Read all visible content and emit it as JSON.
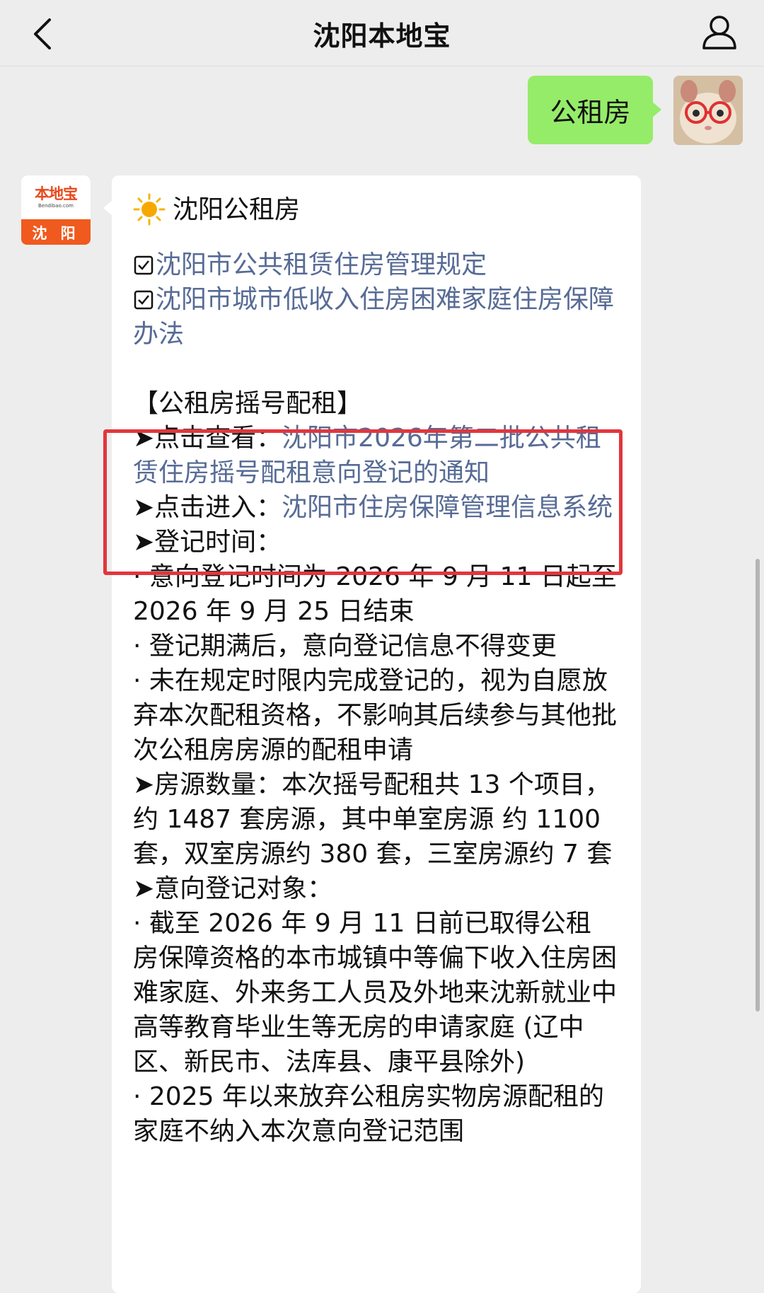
{
  "nav": {
    "title": "沈阳本地宝"
  },
  "user_message": {
    "text": "公租房"
  },
  "bot_avatar": {
    "brand": "本地宝",
    "url": "Bendibao.com",
    "city": "沈 阳"
  },
  "bot_message": {
    "heading": "沈阳公租房",
    "links": [
      "沈阳市公共租赁住房管理规定",
      "沈阳市城市低收入住房困难家庭住房保障办法"
    ],
    "section_title": "【公租房摇号配租】",
    "highlight_items": [
      {
        "prefix": "➤点击查看：",
        "link": "沈阳市2026年第二批公共租赁住房摇号配租意向登记的通知"
      },
      {
        "prefix": "➤点击进入：",
        "link": "沈阳市住房保障管理信息系统"
      }
    ],
    "body_lines": [
      "➤登记时间：",
      "· 意向登记时间为 2026 年 9 月 11 日起至 2026 年 9 月 25 日结束",
      "· 登记期满后，意向登记信息不得变更",
      "· 未在规定时限内完成登记的，视为自愿放弃本次配租资格，不影响其后续参与其他批次公租房房源的配租申请",
      "➤房源数量：本次摇号配租共 13 个项目，约 1487 套房源，其中单室房源 约 1100 套，双室房源约 380 套，三室房源约 7 套",
      "➤意向登记对象：",
      "· 截至 2026 年 9 月 11 日前已取得公租 房保障资格的本市城镇中等偏下收入住房困难家庭、外来务工人员及外地来沈新就业中高等教育毕业生等无房的申请家庭 (辽中区、新民市、法库县、康平县除外)",
      "· 2025 年以来放弃公租房实物房源配租的家庭不纳入本次意向登记范围"
    ]
  },
  "colors": {
    "background": "#ededed",
    "user_bubble": "#95ec69",
    "link": "#576b95",
    "highlight_border": "#e2363d"
  },
  "icons": {
    "back": "chevron-left-icon",
    "user": "user-profile-icon",
    "sun": "sun-icon",
    "checkbox": "checkbox-icon"
  }
}
